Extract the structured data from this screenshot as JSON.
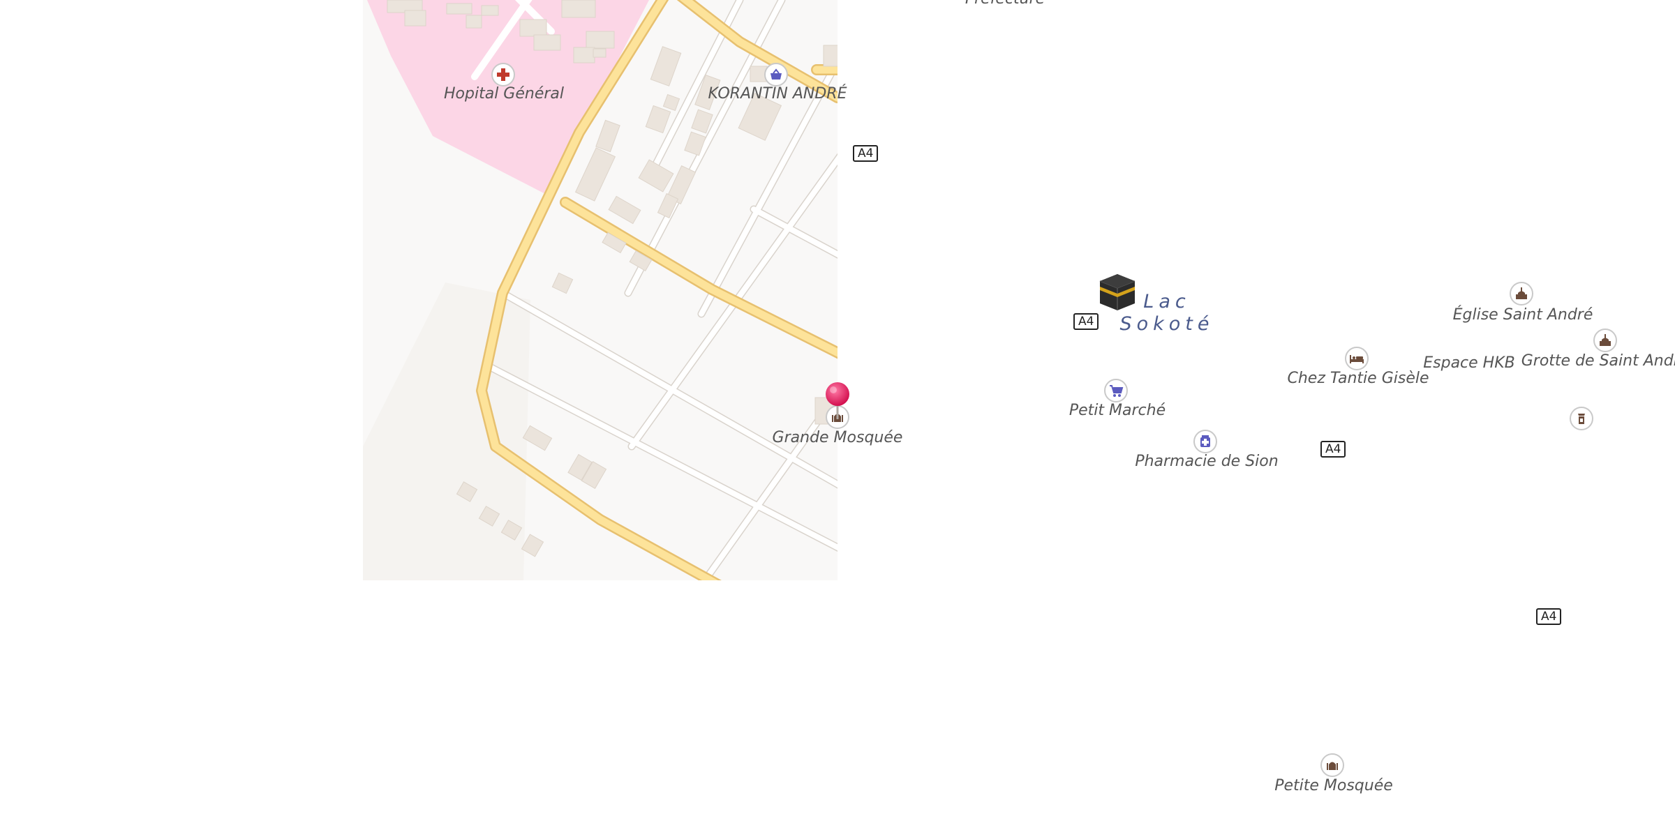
{
  "map": {
    "colors": {
      "hospital_area": "#fcd6e6",
      "road_fill": "#fde39a",
      "road_casing": "#e7c06f",
      "street": "#ffffff",
      "street_casing": "#d9d3cc",
      "building": "#ebe4dc",
      "tile_bg": "#f9f8f7",
      "poi_shop": "#5b5bbf",
      "poi_hospital": "#c0392b",
      "poi_worship": "#6b4c3b",
      "marker": "#e8195c",
      "lake_label": "#4a5a8c"
    },
    "labels": {
      "top_partial": "Préfecture",
      "hospital": "Hopital Général",
      "korantin": "KORANTIN ANDRÉ",
      "grande_mosquee": "Grande Mosquée",
      "petit_marche": "Petit Marché",
      "pharmacie": "Pharmacie de Sion",
      "chez_tantie": "Chez Tantie Gisèle",
      "espace_hkb": "Espace HKB",
      "eglise": "Église Saint André",
      "grotte": "Grotte de Saint André",
      "petite_mosquee": "Petite Mosquée",
      "lake_line1": "Lac",
      "lake_line2": "Sokoté"
    },
    "road_shields": [
      "A4",
      "A4",
      "A4",
      "A4"
    ],
    "icons": {
      "hospital": "hospital-cross-icon",
      "shop": "shopping-basket-icon",
      "worship": "mosque-icon",
      "market": "shopping-cart-icon",
      "pharmacy": "pharmacy-icon",
      "lodging": "bed-icon",
      "church": "church-icon",
      "shrine": "shrine-icon",
      "lake": "kaaba-icon",
      "marker": "location-pin-icon"
    }
  }
}
